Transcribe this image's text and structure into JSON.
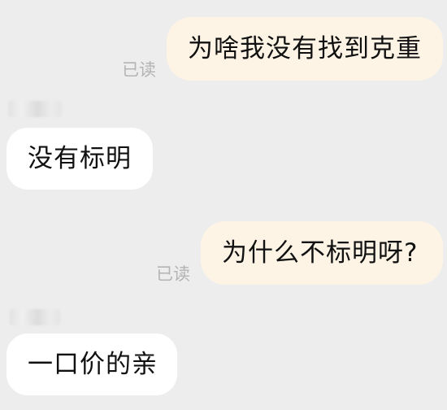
{
  "chat": {
    "messages": [
      {
        "direction": "outgoing",
        "text": "为啥我没有找到克重",
        "read_status": "已读"
      },
      {
        "direction": "incoming",
        "text": "没有标明"
      },
      {
        "direction": "outgoing",
        "text": "为什么不标明呀?",
        "read_status": "已读"
      },
      {
        "direction": "incoming",
        "text": "一口价的亲"
      }
    ]
  },
  "colors": {
    "background": "#ededed",
    "outgoing_bubble": "#fdf4e6",
    "incoming_bubble": "#ffffff",
    "read_status_text": "#b4b4b4",
    "message_text": "#111111"
  }
}
